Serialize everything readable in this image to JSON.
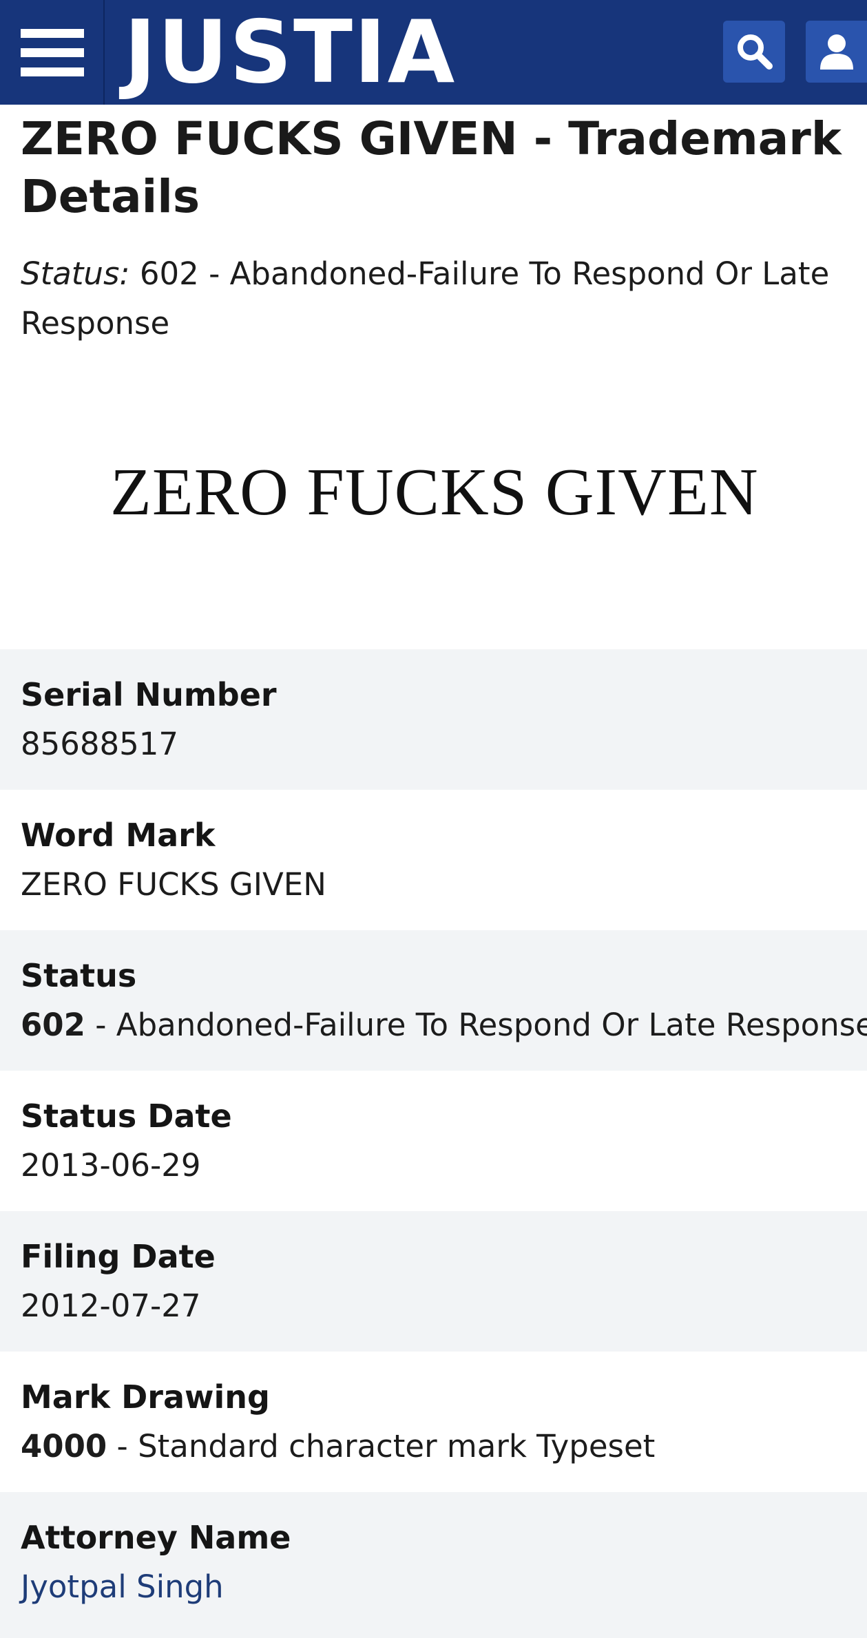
{
  "header": {
    "logo": "JUSTIA",
    "menu_icon": "hamburger-menu-icon",
    "search_icon": "search-icon",
    "account_icon": "user-icon",
    "background": "#17357b",
    "button_color": "#2a54ad"
  },
  "page": {
    "title": "ZERO FUCKS GIVEN - Trademark Details",
    "status_label": "Status:",
    "status_text": "602 - Abandoned-Failure To Respond Or Late Response",
    "mark_image_text": "ZERO FUCKS GIVEN"
  },
  "details": [
    {
      "label": "Serial Number",
      "code": "",
      "value": "85688517"
    },
    {
      "label": "Word Mark",
      "code": "",
      "value": "ZERO FUCKS GIVEN"
    },
    {
      "label": "Status",
      "code": "602",
      "value": " - Abandoned-Failure To Respond Or Late Response"
    },
    {
      "label": "Status Date",
      "code": "",
      "value": "2013-06-29"
    },
    {
      "label": "Filing Date",
      "code": "",
      "value": "2012-07-27"
    },
    {
      "label": "Mark Drawing",
      "code": "4000",
      "value": " - Standard character mark Typeset"
    },
    {
      "label": "Attorney Name",
      "code": "",
      "value": "Jyotpal Singh"
    }
  ],
  "colors": {
    "row_alt_background": "#f2f4f6",
    "link": "#1e3c78"
  }
}
